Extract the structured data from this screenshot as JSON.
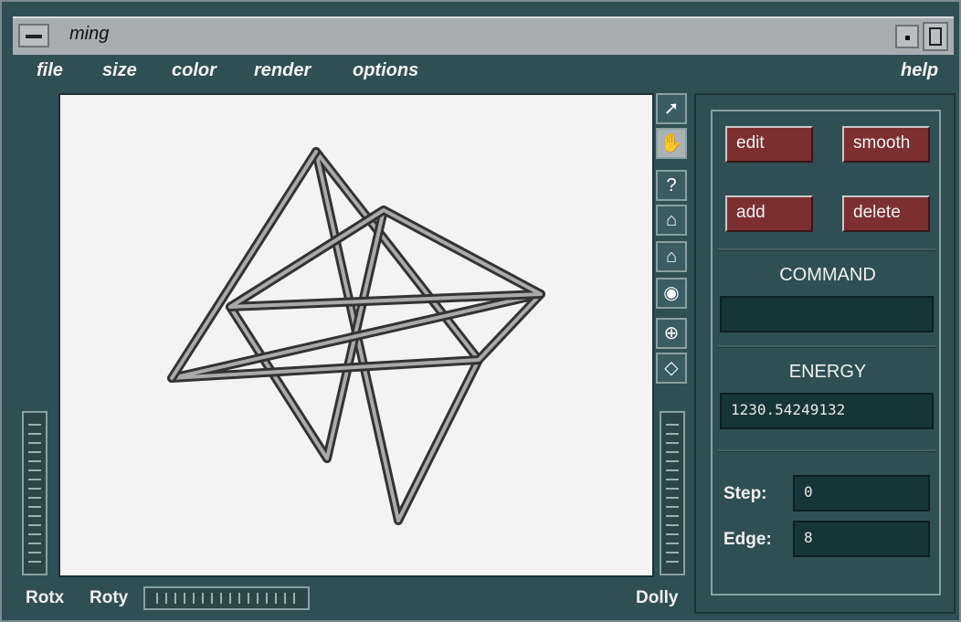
{
  "window": {
    "title": "ming"
  },
  "menu": {
    "file": "file",
    "size": "size",
    "color": "color",
    "render": "render",
    "options": "options",
    "help": "help"
  },
  "tools": [
    {
      "name": "pointer",
      "glyph": "➚"
    },
    {
      "name": "hand",
      "glyph": "✋"
    },
    {
      "name": "help",
      "glyph": "?"
    },
    {
      "name": "home",
      "glyph": "⌂"
    },
    {
      "name": "set-home",
      "glyph": "⌂"
    },
    {
      "name": "view-all",
      "glyph": "◉"
    },
    {
      "name": "seek",
      "glyph": "⊕"
    },
    {
      "name": "perspective",
      "glyph": "◇"
    }
  ],
  "panel": {
    "edit": "edit",
    "smooth": "smooth",
    "add": "add",
    "delete": "delete",
    "command_label": "COMMAND",
    "command_value": "",
    "energy_label": "ENERGY",
    "energy_value": "1230.54249132",
    "step_label": "Step:",
    "step_value": "0",
    "edge_label": "Edge:",
    "edge_value": "8"
  },
  "bottom": {
    "rotx": "Rotx",
    "roty": "Roty",
    "dolly": "Dolly"
  }
}
